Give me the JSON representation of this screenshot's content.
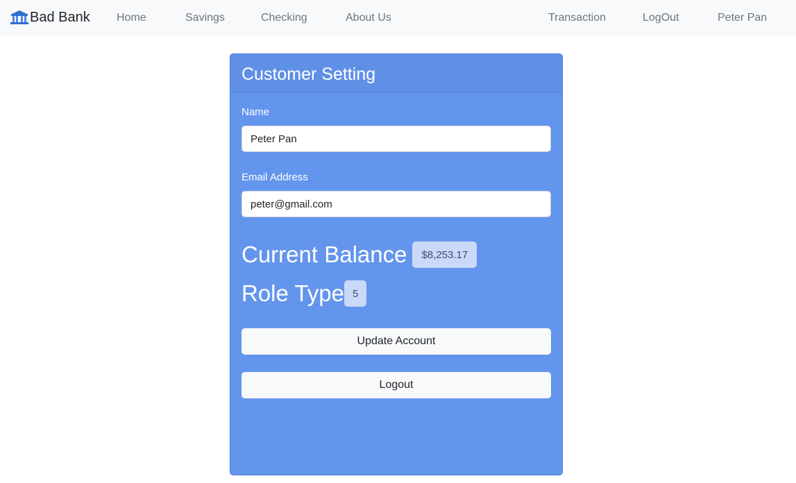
{
  "nav": {
    "brand": "Bad Bank",
    "links": [
      "Home",
      "Savings",
      "Checking",
      "About Us"
    ],
    "right_links": [
      "Transaction",
      "LogOut",
      "Peter Pan"
    ]
  },
  "card": {
    "title": "Customer Setting",
    "name_label": "Name",
    "name_value": "Peter Pan",
    "email_label": "Email Address",
    "email_value": "peter@gmail.com",
    "balance_label": "Current Balance",
    "balance_value": "$8,253.17",
    "role_label": "Role Type",
    "role_value": "5",
    "update_button": "Update Account",
    "logout_button": "Logout"
  }
}
